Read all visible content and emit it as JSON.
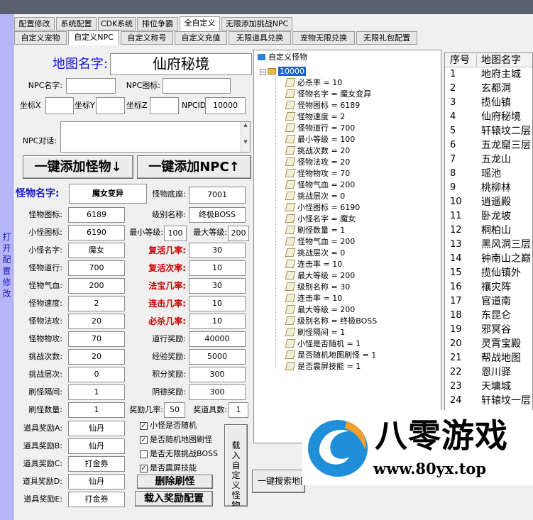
{
  "top_tabs": [
    "配置修改",
    "系统配置",
    "CDK系统",
    "排位争霸",
    "全自定义",
    "无限添加挑战NPC"
  ],
  "sub_tabs": [
    "自定义宠物",
    "自定义NPC",
    "自定义称号",
    "自定义充值",
    "无限道具兑换",
    "宠物无限兑换",
    "无限礼包配置"
  ],
  "left_strip": "打开配置修改",
  "map": {
    "label": "地图名字:",
    "value": "仙府秘境"
  },
  "npc": {
    "name_label": "NPC名字:",
    "icon_label": "NPC图标:",
    "x_label": "坐标X",
    "y_label": "坐标Y",
    "z_label": "坐标Z",
    "id_label": "NPCID",
    "id_value": "10000",
    "dialog_label": "NPC对话:"
  },
  "buttons": {
    "add_monster": "一键添加怪物↓",
    "add_npc": "一键添加NPC↑",
    "delete": "删除刷怪",
    "load_reward": "载入奖励配置",
    "load_custom": "载入自定义怪物",
    "search_map": "一键搜索地图"
  },
  "monster": {
    "name_label": "怪物名字:",
    "name_value": "魔女变异",
    "base_label": "怪物底座:",
    "base_value": "7001",
    "icon_label": "怪物图标:",
    "icon_value": "6189",
    "level_name_label": "级别名称:",
    "level_name_value": "终极BOSS",
    "small_icon_label": "小怪图标:",
    "small_icon_value": "6190",
    "min_level_label": "最小等级:",
    "min_level_value": "100",
    "max_level_label": "最大等级:",
    "max_level_value": "200",
    "small_name_label": "小怪名字:",
    "small_name_value": "魔女",
    "revive_rate_label": "复活几率:",
    "revive_rate_value": "30",
    "dao_label": "怪物道行:",
    "dao_value": "700",
    "revive_times_label": "复活次率:",
    "revive_times_value": "10",
    "hp_label": "怪物气血:",
    "hp_value": "200",
    "magic_rate_label": "法宝几率:",
    "magic_rate_value": "30",
    "speed_label": "怪物速度:",
    "speed_value": "2",
    "combo_rate_label": "连击几率:",
    "combo_rate_value": "10",
    "matk_label": "怪物法攻:",
    "matk_value": "20",
    "kill_rate_label": "必杀几率:",
    "kill_rate_value": "10",
    "patk_label": "怪物物攻:",
    "patk_value": "70",
    "dao_reward_label": "道行奖励:",
    "dao_reward_value": "40000",
    "challenge_label": "挑战次数:",
    "challenge_value": "20",
    "exp_reward_label": "经验奖励:",
    "exp_reward_value": "5000",
    "layer_label": "挑战层次:",
    "layer_value": "0",
    "points_reward_label": "积分奖励:",
    "points_reward_value": "300",
    "interval_label": "刷怪隔间:",
    "interval_value": "1",
    "yinde_reward_label": "阴德奖励:",
    "yinde_reward_value": "300",
    "count_label": "刷怪数量:",
    "count_value": "1",
    "reward_rate_label": "奖励几率:",
    "reward_rate_value": "50",
    "reward_num_label": "奖道具数:",
    "reward_num_value": "1"
  },
  "items": [
    {
      "label": "道具奖励A:",
      "value": "仙丹"
    },
    {
      "label": "道具奖励B:",
      "value": "仙丹"
    },
    {
      "label": "道具奖励C:",
      "value": "打金券"
    },
    {
      "label": "道具奖励D:",
      "value": "仙丹"
    },
    {
      "label": "道具奖励E:",
      "value": "打金券"
    }
  ],
  "checkboxes": [
    {
      "label": "小怪是否随机",
      "checked": "✓"
    },
    {
      "label": "是否随机地图刷怪",
      "checked": "✓"
    },
    {
      "label": "是否无限挑战BOSS",
      "checked": ""
    },
    {
      "label": "是否震屏技能",
      "checked": "✓"
    }
  ],
  "tree": {
    "root": "自定义怪物",
    "child": "10000",
    "items": [
      "必杀率 = 10",
      "怪物名字 = 魔女变异",
      "怪物图标 = 6189",
      "怪物速度 = 2",
      "怪物道行 = 700",
      "最小等级 = 100",
      "挑战次数 = 20",
      "怪物法攻 = 20",
      "怪物物攻 = 70",
      "怪物气血 = 200",
      "挑战层次 = 0",
      "小怪图标 = 6190",
      "小怪名字 = 魔女",
      "刷怪数量 = 1",
      "怪物气血 = 200",
      "挑战层次 = 0",
      "连击率 = 10",
      "最大等级 = 200",
      "级别名称 = 30",
      "连击率 = 10",
      "最大等级 = 200",
      "级别名称 = 终极BOSS",
      "刷怪隔间 = 1",
      "小怪是否随机 = 1",
      "是否随机地图刷怪 = 1",
      "是否震屏技能 = 1"
    ]
  },
  "map_list": {
    "headers": [
      "序号",
      "地图名字"
    ],
    "rows": [
      [
        "1",
        "地府主城"
      ],
      [
        "2",
        "玄都洞"
      ],
      [
        "3",
        "揽仙镇"
      ],
      [
        "4",
        "仙府秘境"
      ],
      [
        "5",
        "轩辕坟二层"
      ],
      [
        "6",
        "五龙窟三层"
      ],
      [
        "7",
        "五龙山"
      ],
      [
        "8",
        "瑶池"
      ],
      [
        "9",
        "桃柳林"
      ],
      [
        "10",
        "逍遥殿"
      ],
      [
        "11",
        "卧龙坡"
      ],
      [
        "12",
        "桐柏山"
      ],
      [
        "13",
        "黑风洞三层"
      ],
      [
        "14",
        "钟南山之巅"
      ],
      [
        "15",
        "揽仙镇外"
      ],
      [
        "16",
        "禳灾阵"
      ],
      [
        "17",
        "官道南"
      ],
      [
        "18",
        "东昆仑"
      ],
      [
        "19",
        "邪冥谷"
      ],
      [
        "20",
        "灵霄宝殿"
      ],
      [
        "21",
        "帮战地图"
      ],
      [
        "22",
        "恩川驿"
      ],
      [
        "23",
        "天墉城"
      ],
      [
        "24",
        "轩辕坟一层"
      ]
    ]
  },
  "logo": {
    "text": "八零游戏",
    "url": "www.80yx.top"
  },
  "colors": {
    "accent_blue": "#1414d2",
    "red_label": "#c80000",
    "side_strip": "#b5b5f8"
  }
}
